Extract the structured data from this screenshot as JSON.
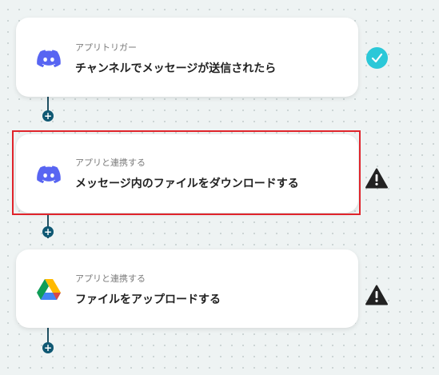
{
  "steps": [
    {
      "label": "アプリトリガー",
      "title": "チャンネルでメッセージが送信されたら",
      "app_icon": "discord-icon",
      "status": "success"
    },
    {
      "label": "アプリと連携する",
      "title": "メッセージ内のファイルをダウンロードする",
      "app_icon": "discord-icon",
      "status": "warning",
      "selected": true
    },
    {
      "label": "アプリと連携する",
      "title": "ファイルをアップロードする",
      "app_icon": "google-drive-icon",
      "status": "warning"
    }
  ],
  "add_button_label": "+",
  "colors": {
    "accent_status_ok": "#2bc8d8",
    "status_warning": "#222222",
    "connector": "#1e4f61",
    "selection_border": "#e0242b",
    "discord": "#5865f2"
  }
}
